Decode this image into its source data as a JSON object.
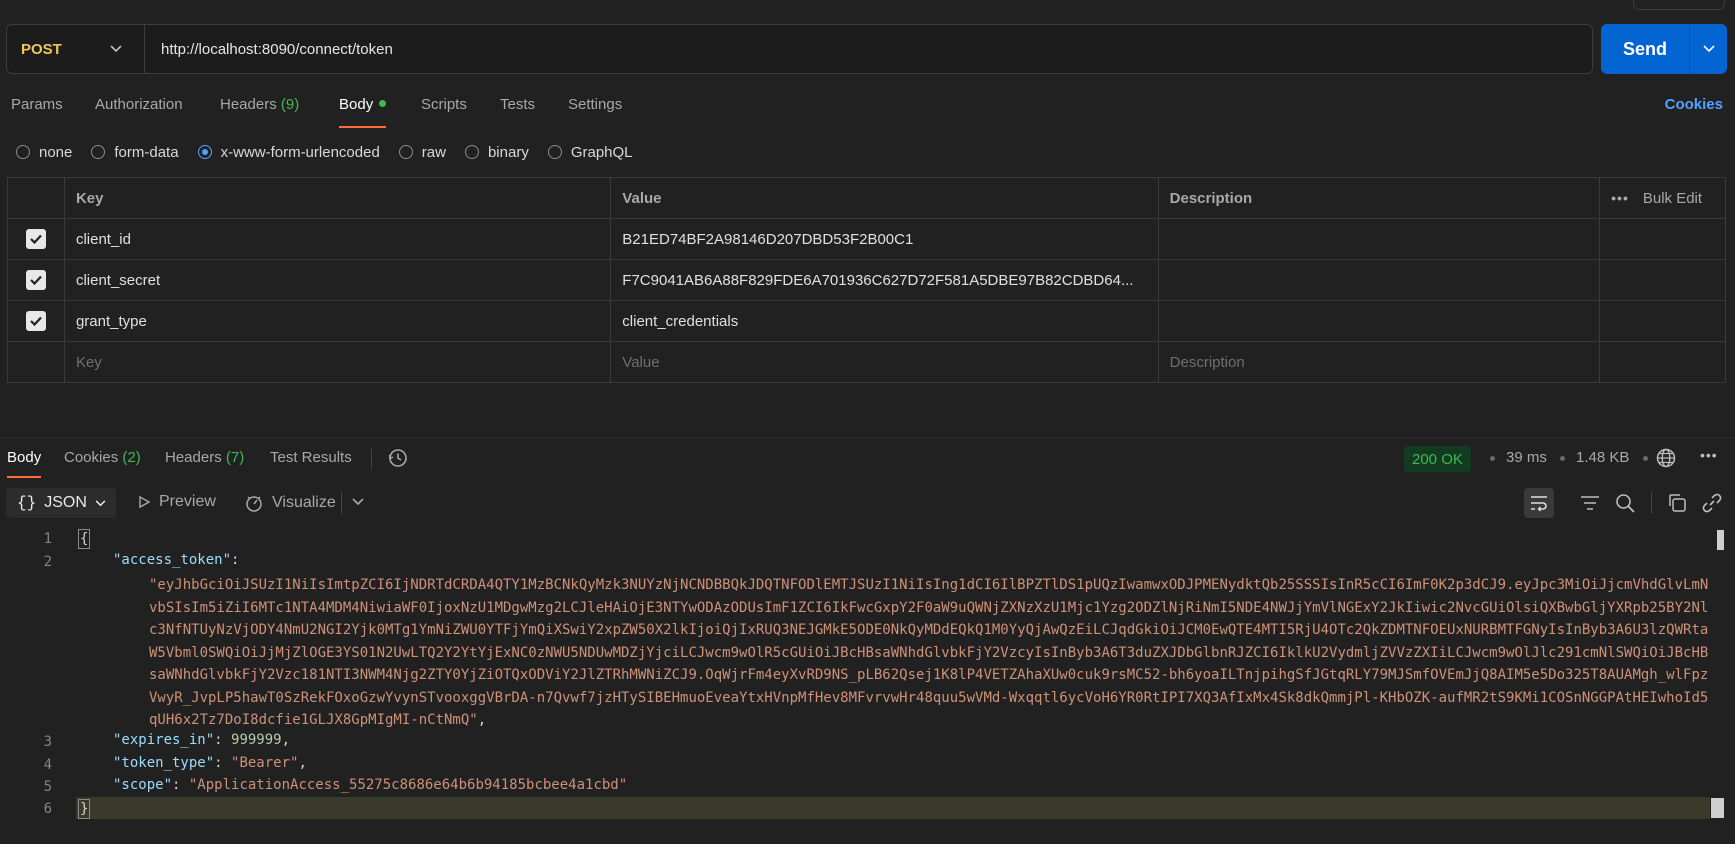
{
  "request": {
    "method": "POST",
    "url": "http://localhost:8090/connect/token",
    "send_label": "Send"
  },
  "request_tabs": [
    {
      "label": "Params"
    },
    {
      "label": "Authorization"
    },
    {
      "label": "Headers",
      "count": "(9)"
    },
    {
      "label": "Body"
    },
    {
      "label": "Scripts"
    },
    {
      "label": "Tests"
    },
    {
      "label": "Settings"
    }
  ],
  "cookies_label": "Cookies",
  "body_types": [
    "none",
    "form-data",
    "x-www-form-urlencoded",
    "raw",
    "binary",
    "GraphQL"
  ],
  "body_type_selected": "x-www-form-urlencoded",
  "params_table": {
    "headers": {
      "key": "Key",
      "value": "Value",
      "description": "Description",
      "bulk_edit": "Bulk Edit"
    },
    "rows": [
      {
        "checked": true,
        "key": "client_id",
        "value": "B21ED74BF2A98146D207DBD53F2B00C1",
        "description": ""
      },
      {
        "checked": true,
        "key": "client_secret",
        "value": "F7C9041AB6A88F829FDE6A701936C627D72F581A5DBE97B82CDBD64...",
        "description": ""
      },
      {
        "checked": true,
        "key": "grant_type",
        "value": "client_credentials",
        "description": ""
      }
    ],
    "placeholder": {
      "key": "Key",
      "value": "Value",
      "description": "Description"
    }
  },
  "response_tabs": [
    {
      "label": "Body"
    },
    {
      "label": "Cookies",
      "count": "(2)"
    },
    {
      "label": "Headers",
      "count": "(7)"
    },
    {
      "label": "Test Results"
    }
  ],
  "response_meta": {
    "status": "200 OK",
    "time": "39 ms",
    "size": "1.48 KB"
  },
  "response_toolbar": {
    "format": "JSON",
    "preview": "Preview",
    "visualize": "Visualize"
  },
  "response_body": {
    "line_numbers": [
      "1",
      "2",
      "3",
      "4",
      "5",
      "6"
    ],
    "open_brace": "{",
    "close_brace": "}",
    "access_token_key": "\"access_token\"",
    "access_token_value": "\"eyJhbGciOiJSUzI1NiIsImtpZCI6IjNDRTdCRDA4QTY1MzBCNkQyMzk3NUYzNjNCNDBBQkJDQTNFODlEMTJSUzI1NiIsIng1dCI6IlBPZTlDS1pUQzIwamwxODJPMENydktQb25SSSIsInR5cCI6ImF0K2p3dCJ9.eyJpc3MiOiJjcmVhdGlvLmNvbSIsIm5iZiI6MTc1NTA4MDM4NiwiaWF0IjoxNzU1MDgwMzg2LCJleHAiOjE3NTYwODAzODUsImF1ZCI6IkFwcGxpY2F0aW9uQWNjZXNzXzU1Mjc1Yzg2ODZlNjRiNmI5NDE4NWJjYmVlNGExY2JkIiwic2NvcGUiOlsiQXBwbGljYXRpb25BY2Nlc3NfNTUyNzVjODY4NmU2NGI2Yjk0MTg1YmNiZWU0YTFjYmQiXSwiY2xpZW50X2lkIjoiQjIxRUQ3NEJGMkE5ODE0NkQyMDdEQkQ1M0YyQjAwQzEiLCJqdGkiOiJCM0EwQTE4MTI5RjU4OTc2QkZDMTNFOEUxNURBMTFGNyIsInByb3A6U3lzQWRtaW5Vbml0SWQiOiJjMjZlOGE3YS01N2UwLTQ2Y2YtYjExNC0zNWU5NDUwMDZjYjciLCJwcm9wOlR5cGUiOiJBcHBsaWNhdGlvbkFjY2VzcyIsInByb3A6T3duZXJDbGlbnRJZCI6IklkU2VydmljZVVzZXIiLCJwcm9wOlJlc291cmNlSWQiOiJBcHBsaWNhdGlvbkFjY2Vzc181NTI3NWM4Njg2ZTY0YjZiOTQxODViY2JlZTRhMWNiZCJ9.OqWjrFm4eyXvRD9NS_pLB62Qsej1K8lP4VETZAhaXUw0cuk9rsMC52-bh6yoaILTnjpihgSfJGtqRLY79MJSmfOVEmJjQ8AIM5e5Do325T8AUAMgh_wlFpzVwyR_JvpLP5hawT0SzRekFOxoGzwYvynSTvooxggVBrDA-n7Qvwf7jzHTySIBEHmuoEveaYtxHVnpMfHev8MFvrvwHr48quu5wVMd-Wxqqtl6ycVoH6YR0RtIPI7XQ3AfIxMx4Sk8dkQmmjPl-KHbOZK-aufMR2tS9KMi1COSnNGGPAtHEIwhoId5qUH6x2Tz7DoI8dcfie1GLJX8GpMIgMI-nCtNmQ\"",
    "expires_in_key": "\"expires_in\"",
    "expires_in_value": "999999",
    "token_type_key": "\"token_type\"",
    "token_type_value": "\"Bearer\"",
    "scope_key": "\"scope\"",
    "scope_value": "\"ApplicationAccess_55275c8686e64b6b94185bcbee4a1cbd\""
  }
}
